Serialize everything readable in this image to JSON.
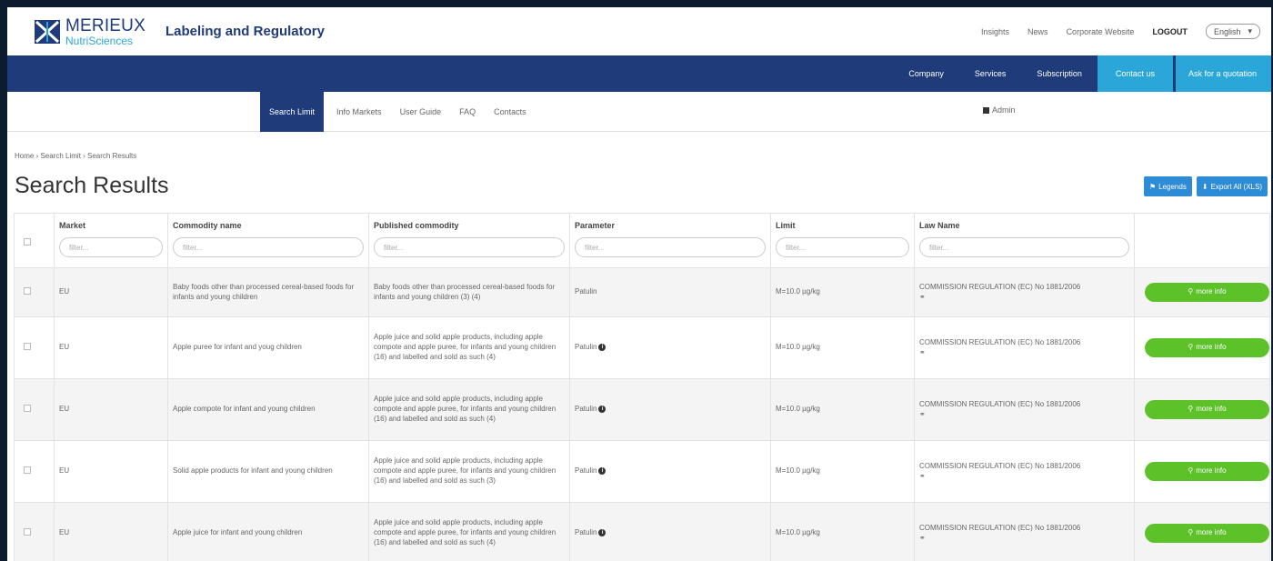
{
  "header": {
    "logo_line1": "MERIEUX",
    "logo_line2": "NutriSciences",
    "app_title": "Labeling and Regulatory",
    "links": [
      "Insights",
      "News",
      "Corporate Website"
    ],
    "logout": "LOGOUT",
    "language": "English"
  },
  "bluebar": {
    "items": [
      "Company",
      "Services",
      "Subscription"
    ],
    "contact": "Contact us",
    "quote": "Ask for a quotation"
  },
  "subnav": {
    "tabs": [
      "Search Limit",
      "Info Markets",
      "User Guide",
      "FAQ",
      "Contacts"
    ],
    "admin": "Admin"
  },
  "breadcrumb": "Home › Search Limit › Search Results",
  "page_title": "Search Results",
  "buttons": {
    "legends": "Legends",
    "export": "Export All (XLS)"
  },
  "table": {
    "columns": [
      "Market",
      "Commodity name",
      "Published commodity",
      "Parameter",
      "Limit",
      "Law Name"
    ],
    "filter_placeholder": "filter...",
    "more_label": "more info",
    "rows": [
      {
        "market": "EU",
        "commodity": "Baby foods other than processed cereal-based foods for infants and young children",
        "published": "Baby foods other than processed cereal-based foods for infants and young children (3) (4)",
        "parameter": "Patulin",
        "limit": "M=10.0 µg/kg",
        "law": "COMMISSION REGULATION (EC) No 1881/2006"
      },
      {
        "market": "EU",
        "commodity": "Apple puree for infant and youg children",
        "published": "Apple juice and solid apple products, including apple compote and apple puree, for infants and young children (16) and labelled and sold as such (4)",
        "parameter": "Patulin",
        "limit": "M=10.0 µg/kg",
        "law": "COMMISSION REGULATION (EC) No 1881/2006"
      },
      {
        "market": "EU",
        "commodity": "Apple compote for infant and young children",
        "published": "Apple juice and solid apple products, including apple compote and apple puree, for infants and young children (16) and labelled and sold as such (4)",
        "parameter": "Patulin",
        "limit": "M=10.0 µg/kg",
        "law": "COMMISSION REGULATION (EC) No 1881/2006"
      },
      {
        "market": "EU",
        "commodity": "Solid apple products for infant and young children",
        "published": "Apple juice and solid apple products, including apple compote and apple puree, for infants and young children (16) and labelled and sold as such (3)",
        "parameter": "Patulin",
        "limit": "M=10.0 µg/kg",
        "law": "COMMISSION REGULATION (EC) No 1881/2006"
      },
      {
        "market": "EU",
        "commodity": "Apple juice for infant and young children",
        "published": "Apple juice and solid apple products, including apple compote and apple puree, for infants and young children (16) and labelled and sold as such (4)",
        "parameter": "Patulin",
        "limit": "M=10.0 µg/kg",
        "law": "COMMISSION REGULATION (EC) No 1881/2006"
      }
    ]
  },
  "colors": {
    "navy": "#1f3b7a",
    "cyan": "#2aa7d8",
    "green": "#5dc12a",
    "blue_button": "#2e8bd6"
  }
}
